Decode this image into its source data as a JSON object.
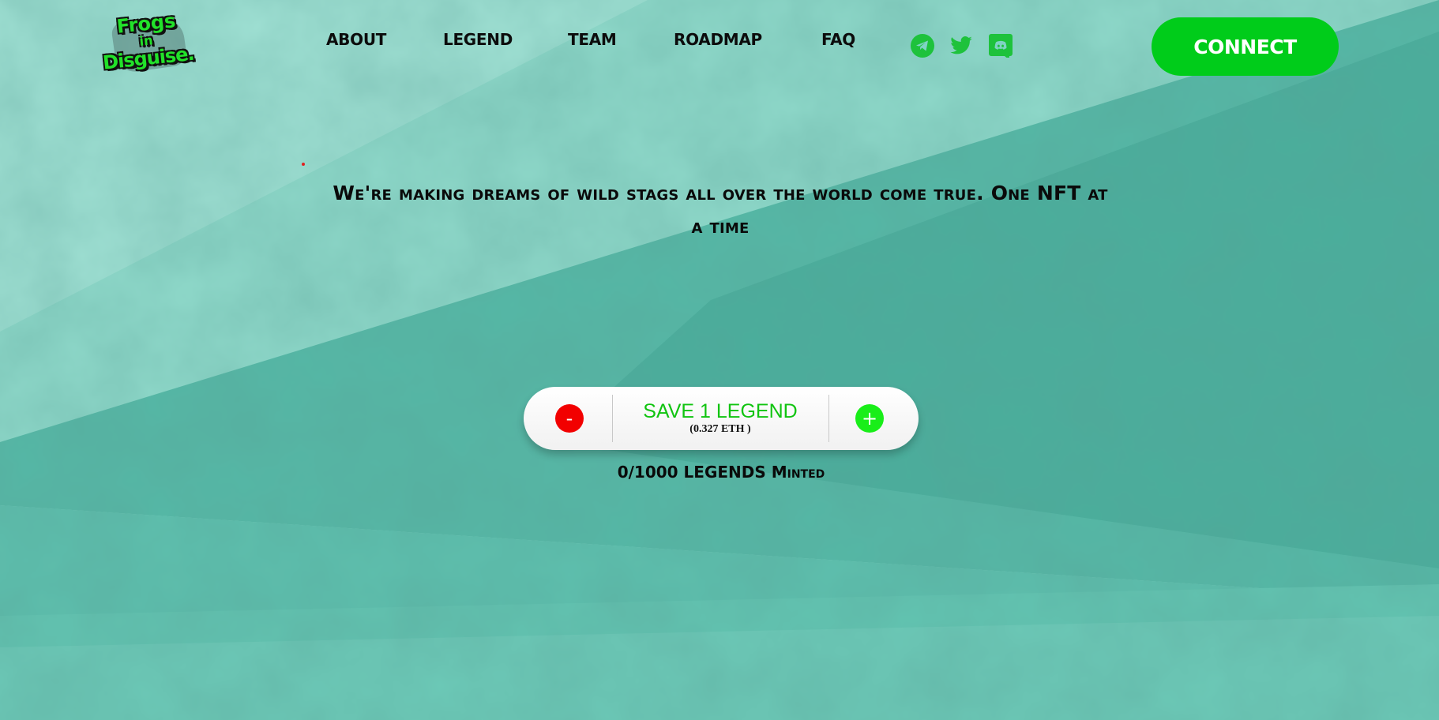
{
  "brand": {
    "logo_line1": "Frogs",
    "logo_line2": "in",
    "logo_line3": "Disguise."
  },
  "nav": {
    "items": [
      {
        "label": "ABOUT"
      },
      {
        "label": "LEGEND"
      },
      {
        "label": "TEAM"
      },
      {
        "label": "ROADMAP"
      },
      {
        "label": "FAQ"
      }
    ]
  },
  "socials": [
    {
      "icon": "telegram-icon"
    },
    {
      "icon": "twitter-icon"
    },
    {
      "icon": "discord-icon"
    }
  ],
  "connect_label": "CONNECT",
  "hero": {
    "headline": "We're making dreams of wild stags all over the world come true. One NFT at a time"
  },
  "mint": {
    "minus_label": "-",
    "plus_label": "+",
    "save_label": "SAVE 1 LEGEND",
    "price": "(0.327 ETH )",
    "minted_status": "0/1000 LEGENDS Minted"
  },
  "colors": {
    "brand_green": "#00cc1a",
    "minus_red": "#f20000",
    "plus_green": "#19ee19",
    "social_green": "#1ec23c",
    "background_teal": "#7fd3c4"
  }
}
